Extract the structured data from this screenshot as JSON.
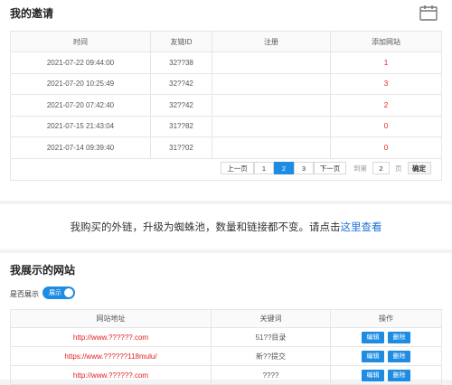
{
  "invite": {
    "title": "我的邀请",
    "icon": "calendar-icon",
    "columns": [
      "时间",
      "友链ID",
      "注册",
      "添加网站"
    ],
    "rows": [
      {
        "time": "2021-07-22 09:44:00",
        "id": "32??38",
        "reg": "",
        "added": "1"
      },
      {
        "time": "2021-07-20 10:25:49",
        "id": "32??42",
        "reg": "",
        "added": "3"
      },
      {
        "time": "2021-07-20 07:42:40",
        "id": "32??42",
        "reg": "",
        "added": "2"
      },
      {
        "time": "2021-07-15 21:43:04",
        "id": "31??82",
        "reg": "",
        "added": "0"
      },
      {
        "time": "2021-07-14 09:39:40",
        "id": "31??02",
        "reg": "",
        "added": "0"
      }
    ],
    "pagination": {
      "prev": "上一页",
      "pages": [
        "1",
        "2",
        "3"
      ],
      "current": "2",
      "next": "下一页",
      "goto_label": "到第",
      "goto_value": "2",
      "page_unit": "页",
      "confirm": "确定"
    }
  },
  "notice": {
    "text": "我购买的外链，升级为蜘蛛池，数量和链接都不变。请点击",
    "link": "这里查看"
  },
  "sites": {
    "title": "我展示的网站",
    "toggle_label": "是否展示",
    "toggle_text": "展示",
    "toggle_on": true,
    "columns": [
      "网站地址",
      "关键词",
      "操作"
    ],
    "rows": [
      {
        "url": "http://www.??????.com",
        "keyword": "51??目录"
      },
      {
        "url": "https://www.??????118mulu/",
        "keyword": "新??提交"
      },
      {
        "url": "http://www.??????.com",
        "keyword": "????"
      }
    ],
    "edit_label": "编辑",
    "delete_label": "删除"
  },
  "colors": {
    "accent": "#1e8ce2",
    "red": "#e02020",
    "link": "#1e6fd9"
  }
}
